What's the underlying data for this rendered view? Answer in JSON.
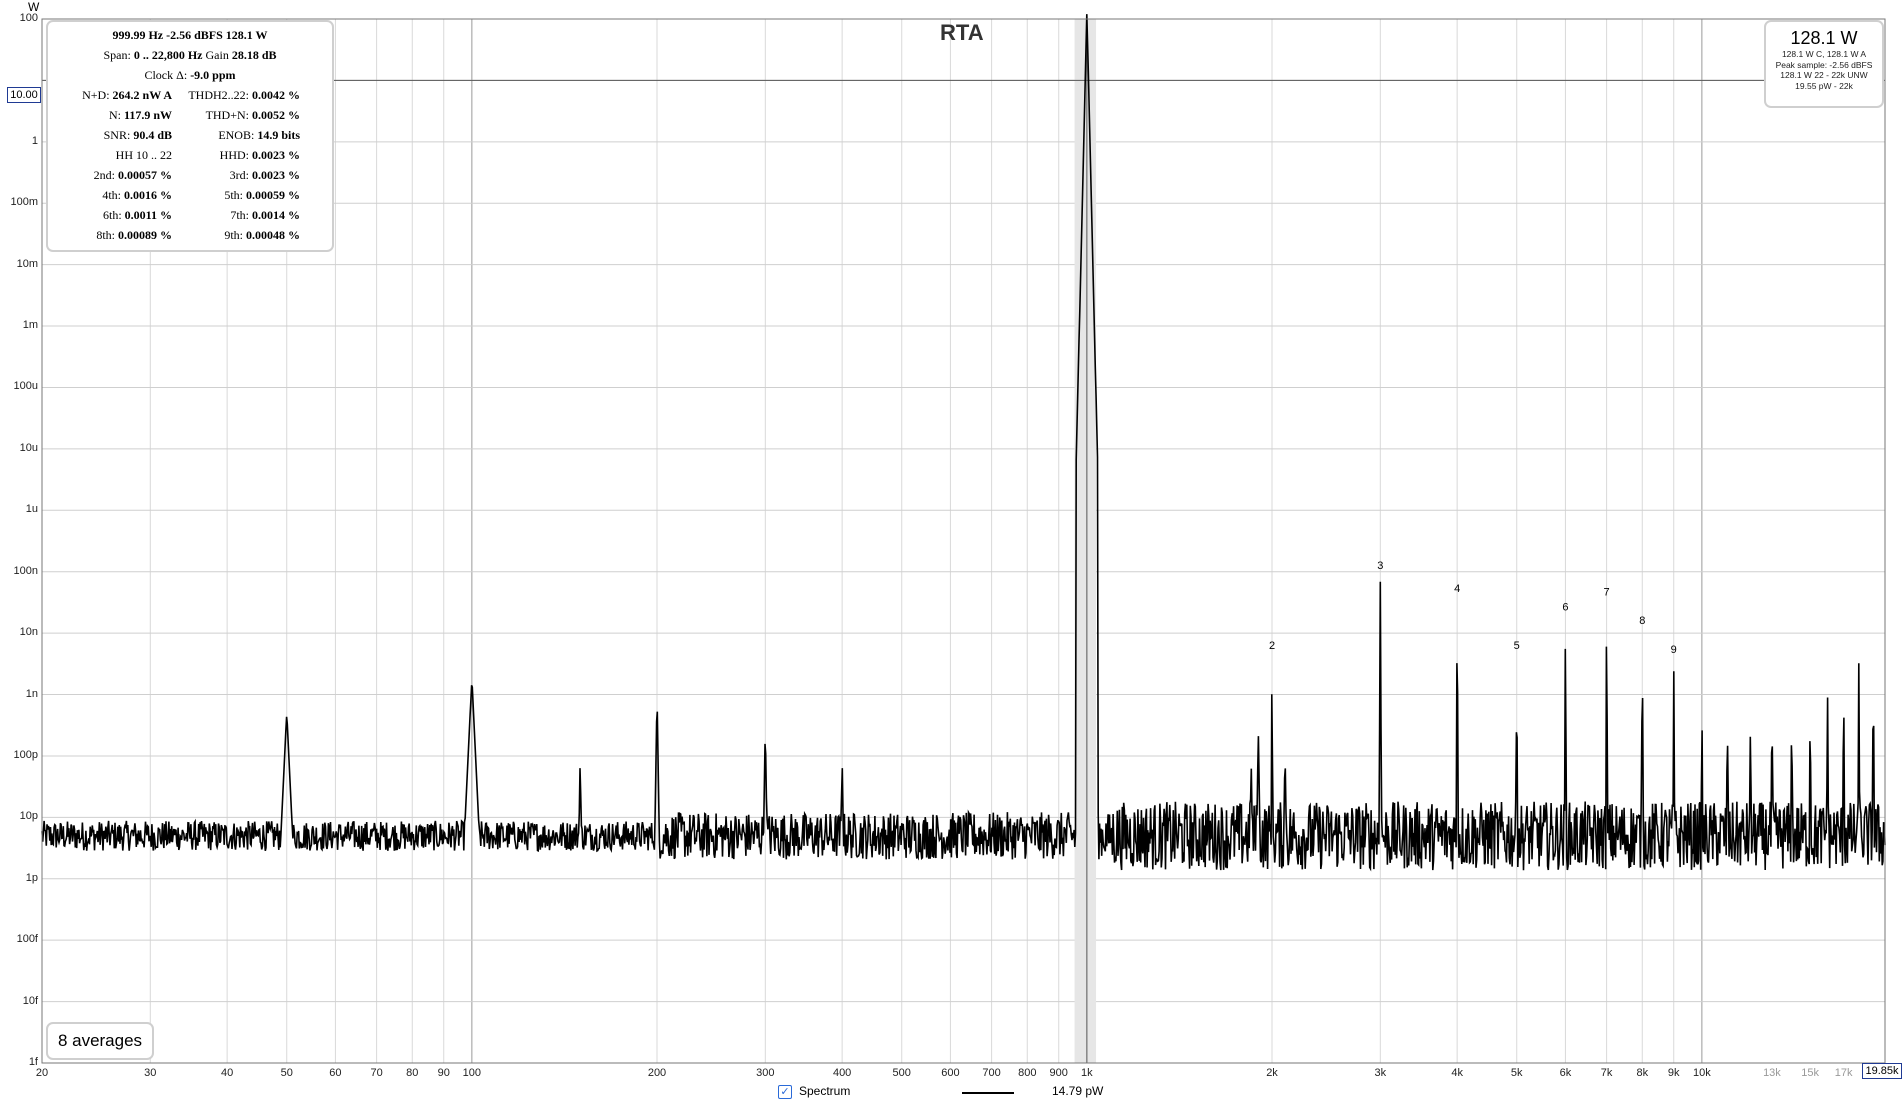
{
  "chart_data": {
    "type": "line",
    "title": "RTA",
    "y_unit_label": "W",
    "x_scale": "log",
    "y_scale": "log",
    "xlim": [
      20,
      19850
    ],
    "ylim": [
      1e-15,
      100
    ],
    "grid": true,
    "x_tick_labels": [
      {
        "v": 20,
        "t": "20"
      },
      {
        "v": 30,
        "t": "30"
      },
      {
        "v": 40,
        "t": "40"
      },
      {
        "v": 50,
        "t": "50"
      },
      {
        "v": 60,
        "t": "60"
      },
      {
        "v": 70,
        "t": "70"
      },
      {
        "v": 80,
        "t": "80"
      },
      {
        "v": 90,
        "t": "90"
      },
      {
        "v": 100,
        "t": "100"
      },
      {
        "v": 200,
        "t": "200"
      },
      {
        "v": 300,
        "t": "300"
      },
      {
        "v": 400,
        "t": "400"
      },
      {
        "v": 500,
        "t": "500"
      },
      {
        "v": 600,
        "t": "600"
      },
      {
        "v": 700,
        "t": "700"
      },
      {
        "v": 800,
        "t": "800"
      },
      {
        "v": 900,
        "t": "900"
      },
      {
        "v": 1000,
        "t": "1k"
      },
      {
        "v": 2000,
        "t": "2k"
      },
      {
        "v": 3000,
        "t": "3k"
      },
      {
        "v": 4000,
        "t": "4k"
      },
      {
        "v": 5000,
        "t": "5k"
      },
      {
        "v": 6000,
        "t": "6k"
      },
      {
        "v": 7000,
        "t": "7k"
      },
      {
        "v": 8000,
        "t": "8k"
      },
      {
        "v": 9000,
        "t": "9k"
      },
      {
        "v": 10000,
        "t": "10k"
      },
      {
        "v": 13000,
        "t": "13k",
        "grey": true
      },
      {
        "v": 15000,
        "t": "15k",
        "grey": true
      },
      {
        "v": 17000,
        "t": "17k",
        "grey": true
      }
    ],
    "y_tick_labels": [
      {
        "v": 100,
        "t": "100"
      },
      {
        "v": 1,
        "t": "1"
      },
      {
        "v": 0.1,
        "t": "100m"
      },
      {
        "v": 0.01,
        "t": "10m"
      },
      {
        "v": 0.001,
        "t": "1m"
      },
      {
        "v": 0.0001,
        "t": "100u"
      },
      {
        "v": 1e-05,
        "t": "10u"
      },
      {
        "v": 1e-06,
        "t": "1u"
      },
      {
        "v": 1e-07,
        "t": "100n"
      },
      {
        "v": 1e-08,
        "t": "10n"
      },
      {
        "v": 1e-09,
        "t": "1n"
      },
      {
        "v": 1e-10,
        "t": "100p"
      },
      {
        "v": 1e-11,
        "t": "10p"
      },
      {
        "v": 1e-12,
        "t": "1p"
      },
      {
        "v": 1e-13,
        "t": "100f"
      },
      {
        "v": 1e-14,
        "t": "10f"
      },
      {
        "v": 1e-15,
        "t": "1f"
      }
    ],
    "fundamental": {
      "freq": 999.99,
      "power": 128.1
    },
    "noise_floor": 5e-12,
    "harmonics": [
      {
        "n": "2",
        "freq": 2000,
        "power": 3.5e-09
      },
      {
        "n": "3",
        "freq": 3000,
        "power": 7e-08
      },
      {
        "n": "4",
        "freq": 4000,
        "power": 3e-08
      },
      {
        "n": "5",
        "freq": 5000,
        "power": 3.5e-09
      },
      {
        "n": "6",
        "freq": 6000,
        "power": 1.5e-08
      },
      {
        "n": "7",
        "freq": 7000,
        "power": 2.6e-08
      },
      {
        "n": "8",
        "freq": 8000,
        "power": 9e-09
      },
      {
        "n": "9",
        "freq": 9000,
        "power": 3e-09
      }
    ],
    "high_harmonics": [
      {
        "freq": 10000,
        "power": 2.5e-09
      },
      {
        "freq": 11000,
        "power": 2.5e-09
      },
      {
        "freq": 12000,
        "power": 2.2e-09
      },
      {
        "freq": 13000,
        "power": 3.5e-09
      },
      {
        "freq": 14000,
        "power": 2.8e-09
      },
      {
        "freq": 15000,
        "power": 3.2e-09
      },
      {
        "freq": 16000,
        "power": 4.5e-09
      },
      {
        "freq": 17000,
        "power": 6e-09
      },
      {
        "freq": 18000,
        "power": 8e-09
      },
      {
        "freq": 19000,
        "power": 8e-09
      }
    ],
    "spurs": [
      {
        "freq": 50,
        "power": 5e-10
      },
      {
        "freq": 100,
        "power": 1.8e-09
      },
      {
        "freq": 150,
        "power": 9e-11
      },
      {
        "freq": 200,
        "power": 1e-09
      },
      {
        "freq": 300,
        "power": 3e-10
      },
      {
        "freq": 400,
        "power": 9e-11
      },
      {
        "freq": 1900,
        "power": 2.5e-10
      },
      {
        "freq": 2100,
        "power": 1.2e-10
      },
      {
        "freq": 1850,
        "power": 8e-11
      }
    ],
    "cursor_y_label": "10.00",
    "cursor_x_label": "19.85k",
    "legend": [
      {
        "name": "Spectrum",
        "value": "14.79 pW"
      }
    ]
  },
  "stats": {
    "line1": "999.99 Hz  -2.56 dBFS  128.1 W",
    "line2_a": "Span: ",
    "line2_b": "0 .. 22,800 Hz",
    "line2_c": "  Gain ",
    "line2_d": "28.18 dB",
    "line3_a": "Clock Δ: ",
    "line3_b": "-9.0 ppm",
    "rows": [
      {
        "l_key": "N+D:",
        "l_val": "264.2 nW A",
        "r_key": "THDH2..22:",
        "r_val": "0.0042 %"
      },
      {
        "l_key": "N:",
        "l_val": "117.9 nW",
        "r_key": "THD+N:",
        "r_val": "0.0052 %"
      },
      {
        "l_key": "SNR:",
        "l_val": "90.4 dB",
        "r_key": "ENOB:",
        "r_val": "14.9 bits"
      },
      {
        "l_key": "HH 10 .. 22",
        "l_val": "",
        "r_key": "HHD:",
        "r_val": "0.0023 %"
      },
      {
        "l_key": "2nd:",
        "l_val": "0.00057 %",
        "r_key": "3rd:",
        "r_val": "0.0023 %"
      },
      {
        "l_key": "4th:",
        "l_val": "0.0016 %",
        "r_key": "5th:",
        "r_val": "0.00059 %"
      },
      {
        "l_key": "6th:",
        "l_val": "0.0011 %",
        "r_key": "7th:",
        "r_val": "0.0014 %"
      },
      {
        "l_key": "8th:",
        "l_val": "0.00089 %",
        "r_key": "9th:",
        "r_val": "0.00048 %"
      }
    ]
  },
  "level": {
    "main": "128.1 W",
    "sub1": "128.1 W C, 128.1 W A",
    "sub2": "Peak sample: -2.56 dBFS",
    "sub3": "128.1 W 22 - 22k UNW",
    "sub4": "19.55 pW - 22k"
  },
  "averages_label": "8 averages"
}
